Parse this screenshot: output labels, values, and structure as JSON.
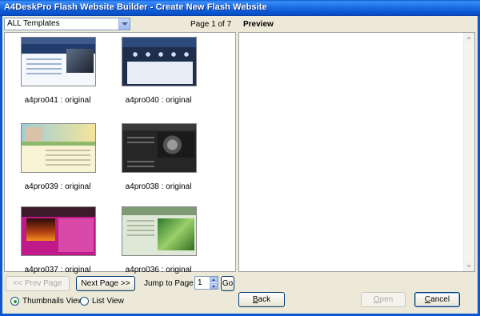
{
  "window": {
    "title": "A4DeskPro Flash Website Builder - Create New Flash Website"
  },
  "filter": {
    "selected": "ALL Templates"
  },
  "pagination": {
    "indicator": "Page 1 of 7"
  },
  "templates": [
    {
      "caption": "a4pro041 : original"
    },
    {
      "caption": "a4pro040 : original"
    },
    {
      "caption": "a4pro039 : original"
    },
    {
      "caption": "a4pro038 : original"
    },
    {
      "caption": "a4pro037 : original"
    },
    {
      "caption": "a4pro036 : original"
    }
  ],
  "preview": {
    "label": "Preview"
  },
  "nav": {
    "prev_label": "<< Prev Page",
    "next_label": "Next Page >>",
    "jump_label": "Jump to Page",
    "jump_value": "1",
    "go_label": "Go"
  },
  "view_mode": {
    "options": [
      {
        "label": "Thumbnails View",
        "selected": true
      },
      {
        "label": "List View",
        "selected": false
      }
    ]
  },
  "actions": {
    "back_label": "Back",
    "open_label": "Open",
    "cancel_label": "Cancel"
  }
}
